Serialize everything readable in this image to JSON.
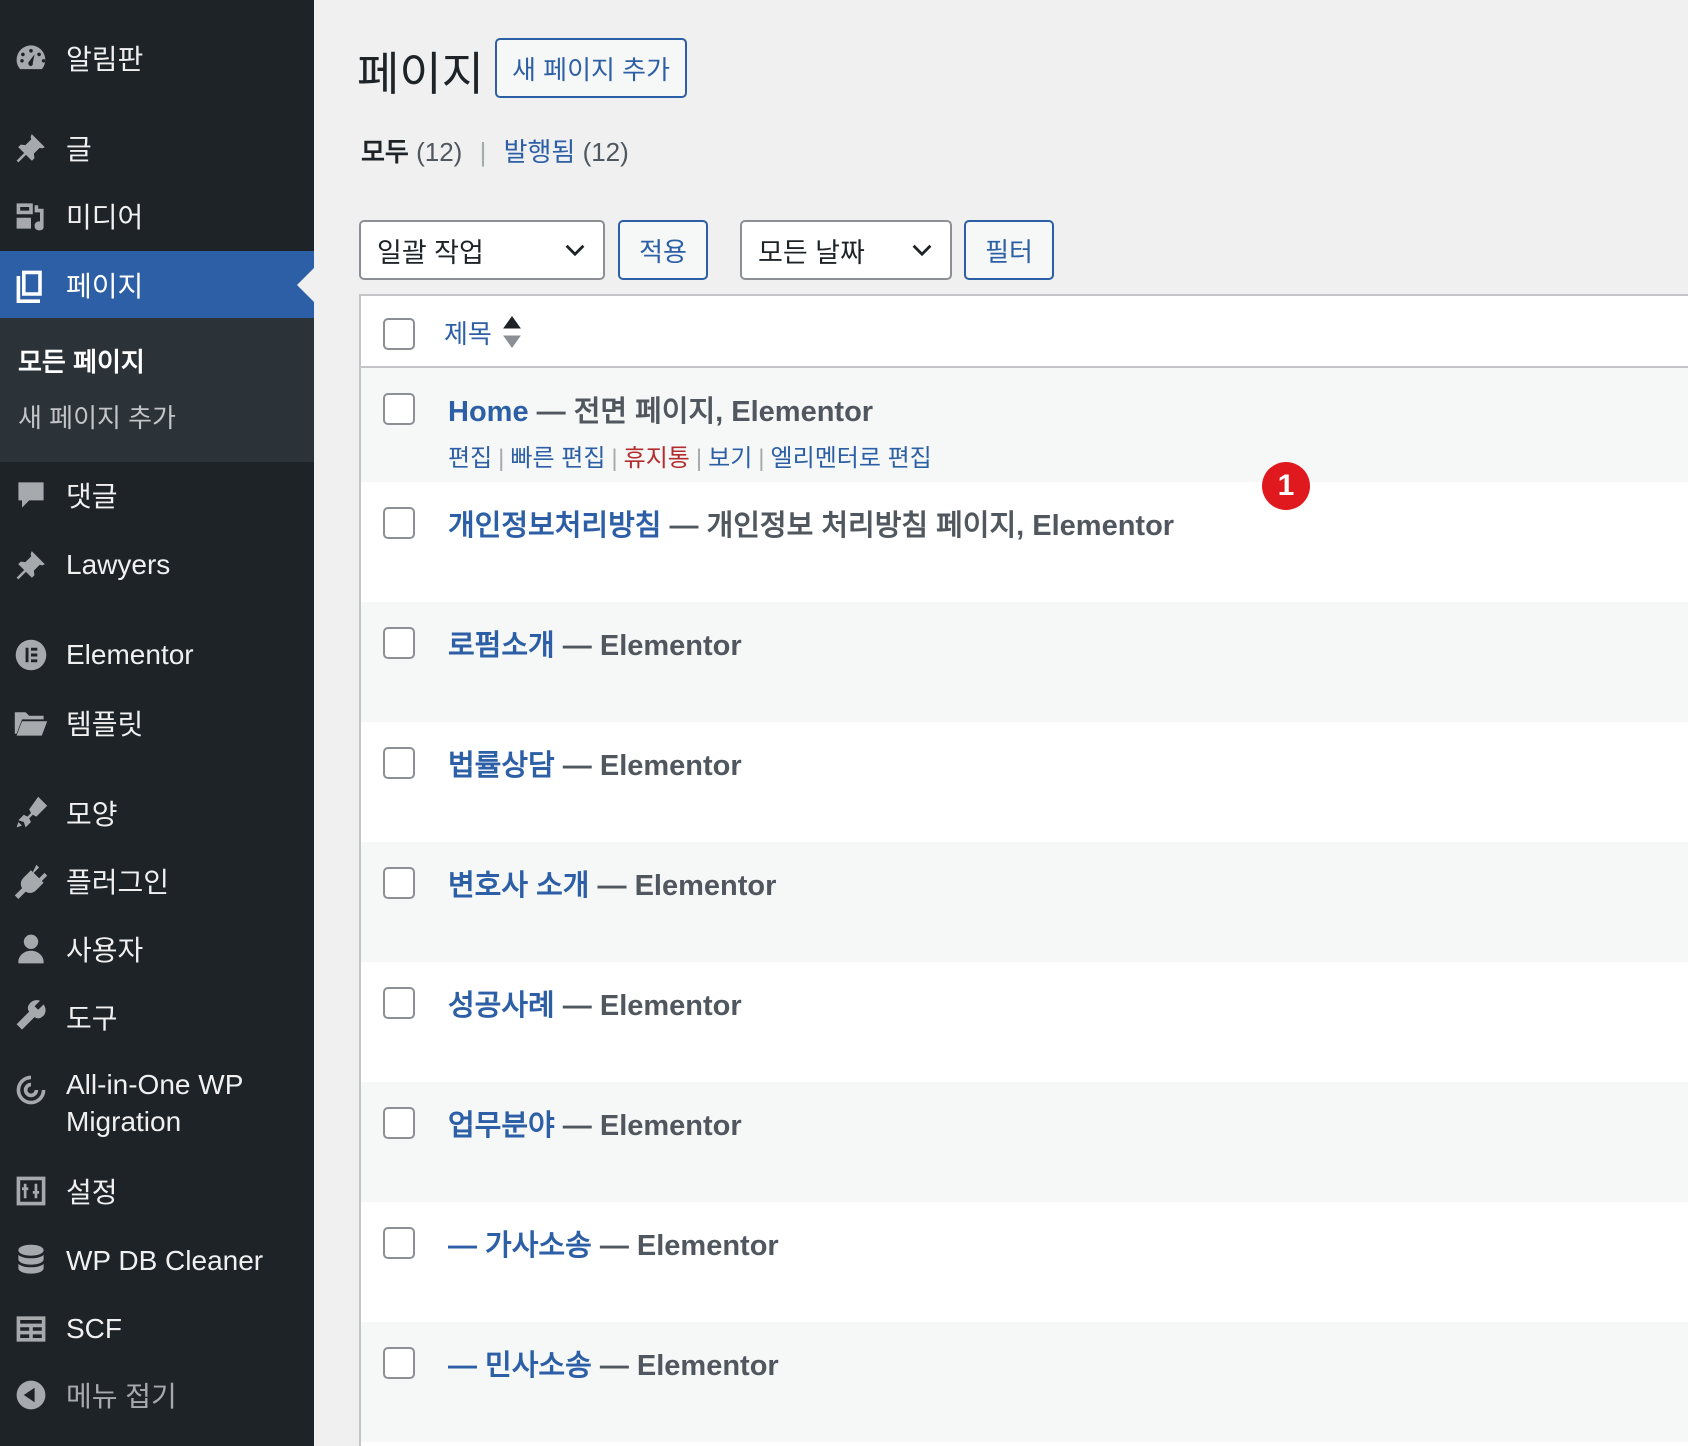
{
  "sidebar": {
    "items": [
      {
        "label": "알림판",
        "icon": "dashboard-icon"
      },
      {
        "label": "글",
        "icon": "pin-icon"
      },
      {
        "label": "미디어",
        "icon": "media-icon"
      },
      {
        "label": "페이지",
        "icon": "pages-icon"
      },
      {
        "label": "댓글",
        "icon": "comment-icon"
      },
      {
        "label": "Lawyers",
        "icon": "pin-icon"
      },
      {
        "label": "Elementor",
        "icon": "elementor-icon"
      },
      {
        "label": "템플릿",
        "icon": "folder-icon"
      },
      {
        "label": "모양",
        "icon": "brush-icon"
      },
      {
        "label": "플러그인",
        "icon": "plugin-icon"
      },
      {
        "label": "사용자",
        "icon": "user-icon"
      },
      {
        "label": "도구",
        "icon": "wrench-icon"
      },
      {
        "label": "All-in-One WP Migration",
        "icon": "migration-icon"
      },
      {
        "label": "설정",
        "icon": "settings-icon"
      },
      {
        "label": "WP DB Cleaner",
        "icon": "database-icon"
      },
      {
        "label": "SCF",
        "icon": "table-icon"
      },
      {
        "label": "메뉴 접기",
        "icon": "collapse-icon"
      }
    ],
    "submenu": [
      {
        "label": "모든 페이지"
      },
      {
        "label": "새 페이지 추가"
      }
    ]
  },
  "header": {
    "title": "페이지",
    "add_new": "새 페이지 추가"
  },
  "views": {
    "all_label": "모두",
    "all_count": "(12)",
    "separator": "|",
    "published_label": "발행됨",
    "published_count": "(12)"
  },
  "toolbar": {
    "bulk_action": "일괄 작업",
    "apply": "적용",
    "date_filter": "모든 날짜",
    "filter": "필터"
  },
  "table": {
    "column_title": "제목",
    "rows": [
      {
        "title": "Home",
        "suffix": " — 전면 페이지, Elementor"
      },
      {
        "title": "개인정보처리방침",
        "suffix": " — 개인정보 처리방침 페이지, Elementor"
      },
      {
        "title": "로펌소개",
        "suffix": " — Elementor"
      },
      {
        "title": "법률상담",
        "suffix": " — Elementor"
      },
      {
        "title": "변호사 소개",
        "suffix": " — Elementor"
      },
      {
        "title": "성공사례",
        "suffix": " — Elementor"
      },
      {
        "title": "업무분야",
        "suffix": " — Elementor"
      },
      {
        "title": "— 가사소송",
        "suffix": " — Elementor"
      },
      {
        "title": "— 민사소송",
        "suffix": " — Elementor"
      }
    ],
    "row_actions": {
      "edit": "편집",
      "quick_edit": "빠른 편집",
      "trash": "휴지통",
      "view": "보기",
      "elementor_edit": "엘리멘터로 편집",
      "separator": "|"
    }
  },
  "annotation": {
    "badge": "1"
  },
  "colors": {
    "sidebar_bg": "#1d2327",
    "active_bg": "#2c5fa5",
    "link": "#2c5fa5",
    "trash": "#b32d2e",
    "badge": "#e0191e"
  }
}
